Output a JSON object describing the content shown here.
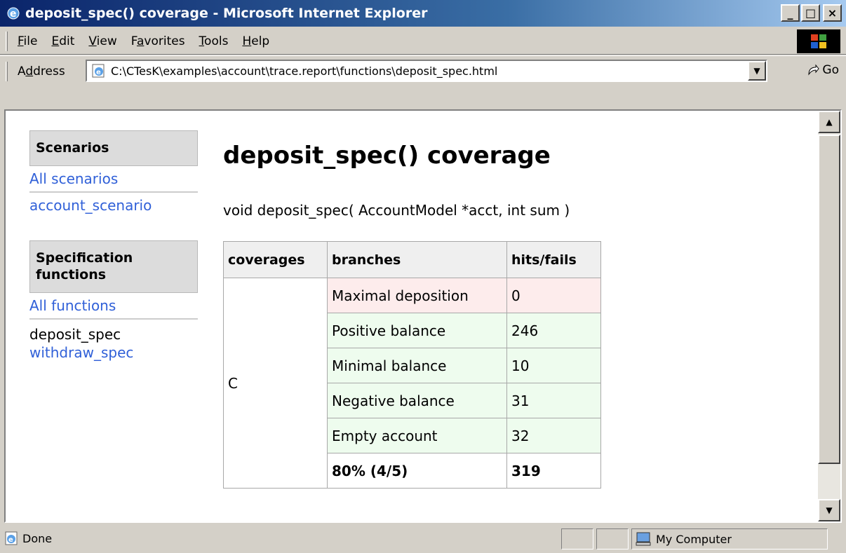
{
  "window": {
    "title": "deposit_spec() coverage - Microsoft Internet Explorer",
    "minimize": "_",
    "maximize": "□",
    "close": "×"
  },
  "menu": {
    "items": [
      {
        "pre": "",
        "key": "F",
        "post": "ile"
      },
      {
        "pre": "",
        "key": "E",
        "post": "dit"
      },
      {
        "pre": "",
        "key": "V",
        "post": "iew"
      },
      {
        "pre": "F",
        "key": "a",
        "post": "vorites"
      },
      {
        "pre": "",
        "key": "T",
        "post": "ools"
      },
      {
        "pre": "",
        "key": "H",
        "post": "elp"
      }
    ]
  },
  "address": {
    "label_pre": "A",
    "label_key": "d",
    "label_post": "dress",
    "url": "C:\\CTesK\\examples\\account\\trace.report\\functions\\deposit_spec.html",
    "go": "Go"
  },
  "sidebar": {
    "scenarios_heading": "Scenarios",
    "all_scenarios": "All scenarios",
    "scenario": "account_scenario",
    "functions_heading": "Specification functions",
    "all_functions": "All functions",
    "current_function": "deposit_spec",
    "other_function": "withdraw_spec"
  },
  "main": {
    "title": "deposit_spec() coverage",
    "signature": "void deposit_spec( AccountModel *acct, int sum )"
  },
  "table": {
    "headers": [
      "coverages",
      "branches",
      "hits/fails"
    ],
    "coverage_name": "C",
    "rows": [
      {
        "branch": "Maximal deposition",
        "hits": "0"
      },
      {
        "branch": "Positive balance",
        "hits": "246"
      },
      {
        "branch": "Minimal balance",
        "hits": "10"
      },
      {
        "branch": "Negative balance",
        "hits": "31"
      },
      {
        "branch": "Empty account",
        "hits": "32"
      }
    ],
    "total": {
      "branch": "80% (4/5)",
      "hits": "319"
    }
  },
  "status": {
    "text": "Done",
    "zone": "My Computer"
  },
  "colors": {
    "link": "#3060d8",
    "fail_row": "#fdecec",
    "pass_row": "#eefcee"
  }
}
